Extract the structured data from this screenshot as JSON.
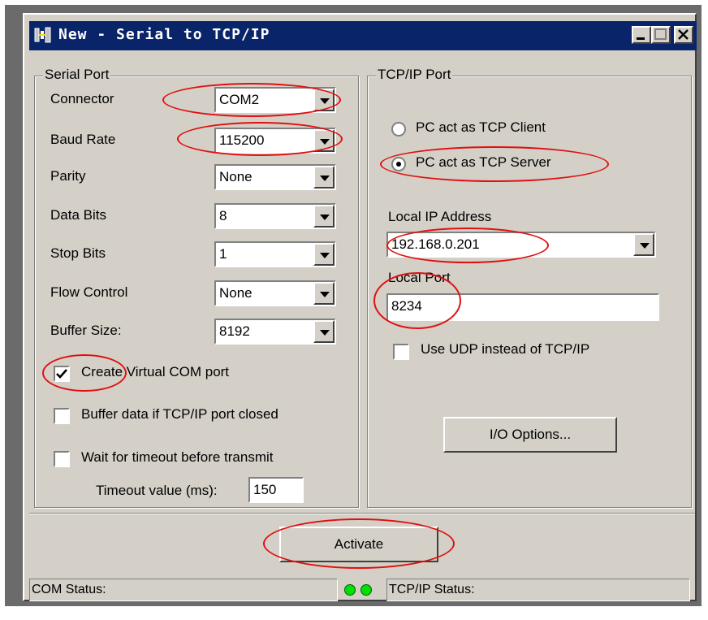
{
  "window": {
    "title": "New - Serial to TCP/IP",
    "icon": "app-network-icon"
  },
  "serial_port": {
    "legend": "Serial Port",
    "fields": [
      {
        "label": "Connector",
        "value": "COM2"
      },
      {
        "label": "Baud Rate",
        "value": "115200"
      },
      {
        "label": "Parity",
        "value": "None"
      },
      {
        "label": "Data Bits",
        "value": "8"
      },
      {
        "label": "Stop Bits",
        "value": "1"
      },
      {
        "label": "Flow Control",
        "value": "None"
      },
      {
        "label": "Buffer Size:",
        "value": "8192"
      }
    ],
    "create_virtual_com": {
      "label": "Create Virtual COM port",
      "checked": true
    },
    "buffer_data": {
      "label": "Buffer data if TCP/IP port closed",
      "checked": false
    },
    "wait_timeout": {
      "label": "Wait for timeout before transmit",
      "checked": false
    },
    "timeout_label": "Timeout value (ms):",
    "timeout_value": "150"
  },
  "tcpip_port": {
    "legend": "TCP/IP Port",
    "client_label": "PC act as TCP Client",
    "server_label": "PC act as TCP Server",
    "selected": "server",
    "local_ip_label": "Local IP Address",
    "local_ip_value": "192.168.0.201",
    "local_port_label": "Local Port",
    "local_port_value": "8234",
    "use_udp": {
      "label": "Use UDP instead of TCP/IP",
      "checked": false
    },
    "io_options_label": "I/O Options..."
  },
  "activate_label": "Activate",
  "status": {
    "com": "COM Status:",
    "tcpip": "TCP/IP Status:"
  },
  "colors": {
    "titlebar": "#0a246a",
    "annotation": "#e01010",
    "led": "#00e000",
    "face": "#d4d0c8"
  }
}
